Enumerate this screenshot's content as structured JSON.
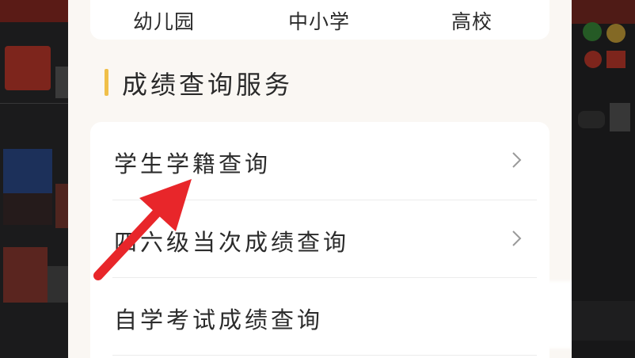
{
  "levels": {
    "kindergarten": "幼儿园",
    "primary_middle": "中小学",
    "college": "高校"
  },
  "section": {
    "title": "成绩查询服务"
  },
  "services": [
    {
      "label": "学生学籍查询",
      "has_chevron": true
    },
    {
      "label": "四六级当次成绩查询",
      "has_chevron": true
    },
    {
      "label": "自学考试成绩查询",
      "has_chevron": false
    }
  ],
  "colors": {
    "accent_bar": "#f0bf49",
    "annotation_arrow": "#e8262a",
    "panel_bg": "#faf7f3",
    "card_bg": "#ffffff",
    "text": "#2b2b2b"
  },
  "icons": {
    "chevron": "chevron-right-icon",
    "annotation": "red-arrow-annotation"
  }
}
